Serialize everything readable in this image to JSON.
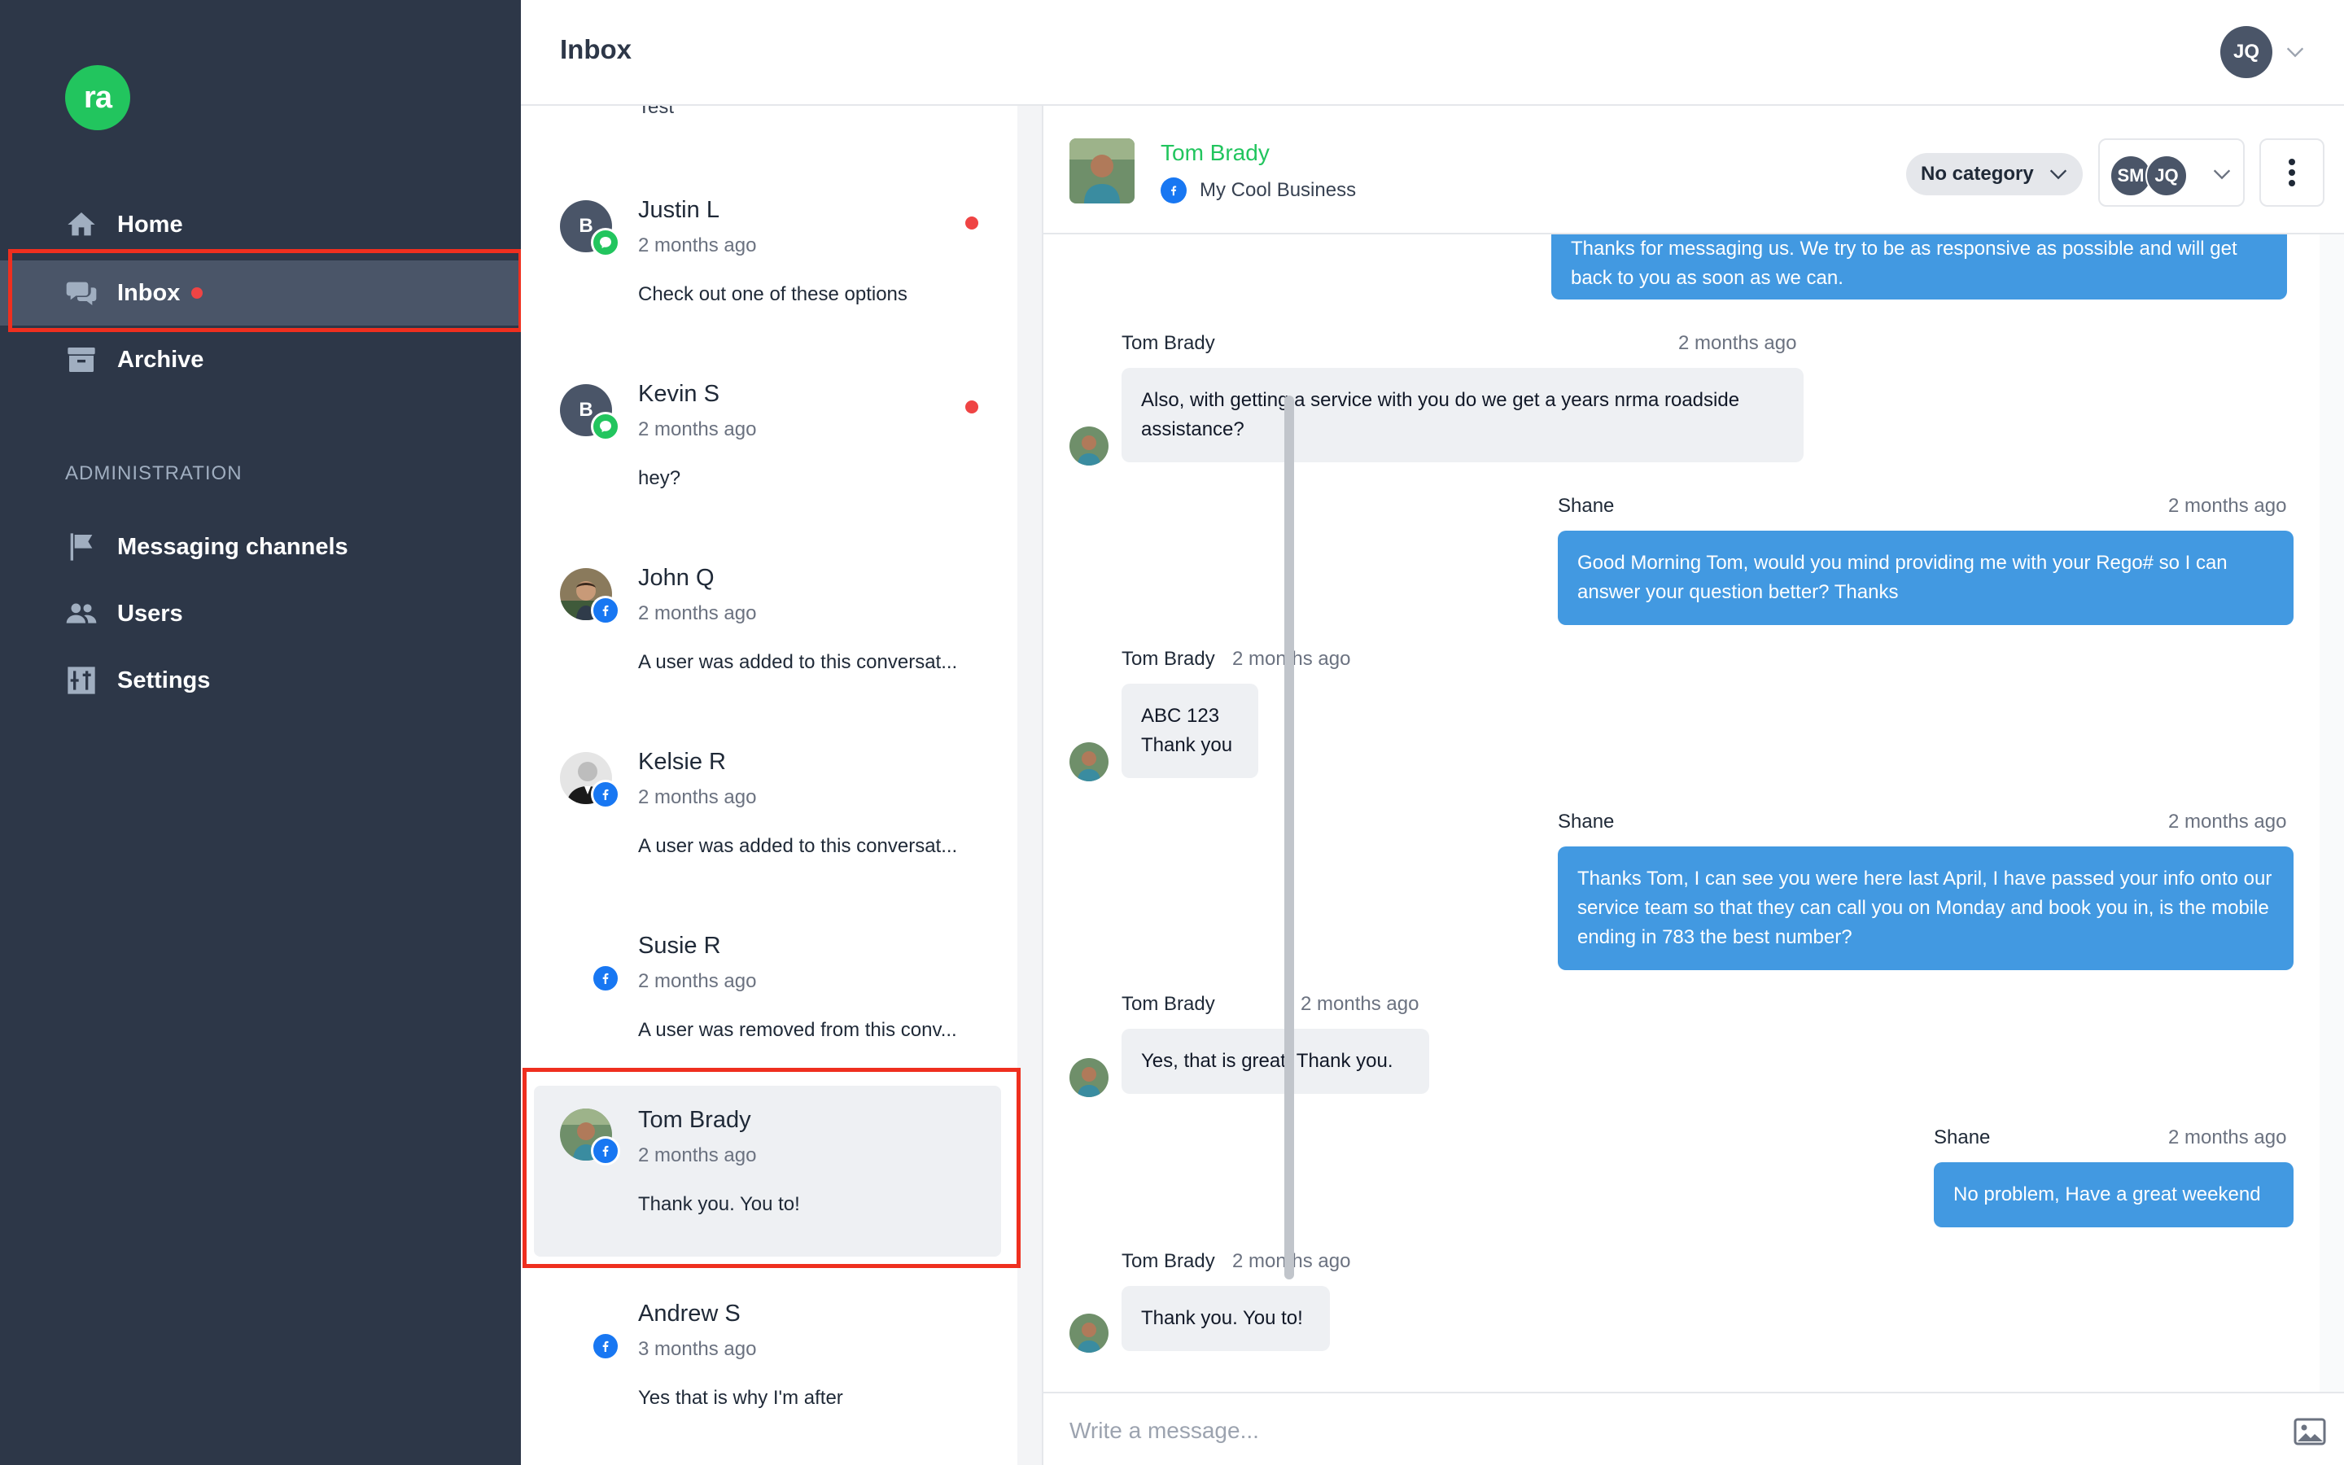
{
  "app": {
    "logo_text": "ra"
  },
  "sidebar": {
    "items": [
      {
        "label": "Home",
        "icon": "home-icon"
      },
      {
        "label": "Inbox",
        "icon": "chat-bubbles-icon",
        "unread": true
      },
      {
        "label": "Archive",
        "icon": "archive-box-icon"
      }
    ],
    "admin_heading": "ADMINISTRATION",
    "admin_items": [
      {
        "label": "Messaging channels",
        "icon": "flag-icon"
      },
      {
        "label": "Users",
        "icon": "users-icon"
      },
      {
        "label": "Settings",
        "icon": "settings-sliders-icon"
      }
    ]
  },
  "header": {
    "title": "Inbox",
    "user_initials": "JQ"
  },
  "conversation_list": {
    "partial_preview": "Test",
    "conversations": [
      {
        "name": "Justin L",
        "time": "2 months ago",
        "preview": "Check out one of these options",
        "avatar_letter": "B",
        "channel": "messenger",
        "unread": true
      },
      {
        "name": "Kevin S",
        "time": "2 months ago",
        "preview": "hey?",
        "avatar_letter": "B",
        "channel": "messenger",
        "unread": true
      },
      {
        "name": "John Q",
        "time": "2 months ago",
        "preview": "A user was added to this conversat...",
        "channel": "facebook",
        "unread": false
      },
      {
        "name": "Kelsie R",
        "time": "2 months ago",
        "preview": "A user was added to this conversat...",
        "channel": "facebook",
        "unread": false
      },
      {
        "name": "Susie R",
        "time": "2 months ago",
        "preview": "A user was removed from this conv...",
        "channel": "facebook",
        "unread": false
      },
      {
        "name": "Tom Brady",
        "time": "2 months ago",
        "preview": "Thank you. You to!",
        "channel": "facebook",
        "unread": false,
        "selected": true
      },
      {
        "name": "Andrew S",
        "time": "3 months ago",
        "preview": "Yes that is why I'm after",
        "channel": "facebook",
        "unread": false
      }
    ]
  },
  "chat": {
    "contact_name": "Tom Brady",
    "channel_name": "My Cool Business",
    "category": "No category",
    "assignees": [
      "SM",
      "JQ"
    ],
    "messages": [
      {
        "direction": "out",
        "sender": "",
        "time": "",
        "text": "Thanks for messaging us. We try to be as responsive as possible and will get back to you as soon as we can."
      },
      {
        "direction": "in",
        "sender": "Tom Brady",
        "time": "2 months ago",
        "text": "Also, with getting a service with you do we get a years nrma roadside assistance?"
      },
      {
        "direction": "out",
        "sender": "Shane",
        "time": "2 months ago",
        "text": "Good Morning Tom, would you mind providing me with your Rego# so I can answer your question better?  Thanks"
      },
      {
        "direction": "in",
        "sender": "Tom Brady",
        "time": "2 months ago",
        "text": "ABC 123\nThank you"
      },
      {
        "direction": "out",
        "sender": "Shane",
        "time": "2 months ago",
        "text": "Thanks Tom, I can see you were here last April, I have passed your info onto our service team so that they can call you on Monday and book you in, is the mobile ending in 783 the best number?"
      },
      {
        "direction": "in",
        "sender": "Tom Brady",
        "time": "2 months ago",
        "text": "Yes, that is great. Thank you."
      },
      {
        "direction": "out",
        "sender": "Shane",
        "time": "2 months ago",
        "text": "No problem, Have a great weekend"
      },
      {
        "direction": "in",
        "sender": "Tom Brady",
        "time": "2 months ago",
        "text": "Thank you. You to!"
      }
    ],
    "composer_placeholder": "Write a message..."
  },
  "colors": {
    "sidebar_bg": "#2d3748",
    "active_nav_bg": "#4a5568",
    "brand_green": "#22c55e",
    "outgoing_bubble": "#4299e1",
    "incoming_bubble": "#eef0f3",
    "unread_dot": "#ef4444",
    "highlight_box": "#ef2f1f",
    "facebook_blue": "#1877f2"
  }
}
